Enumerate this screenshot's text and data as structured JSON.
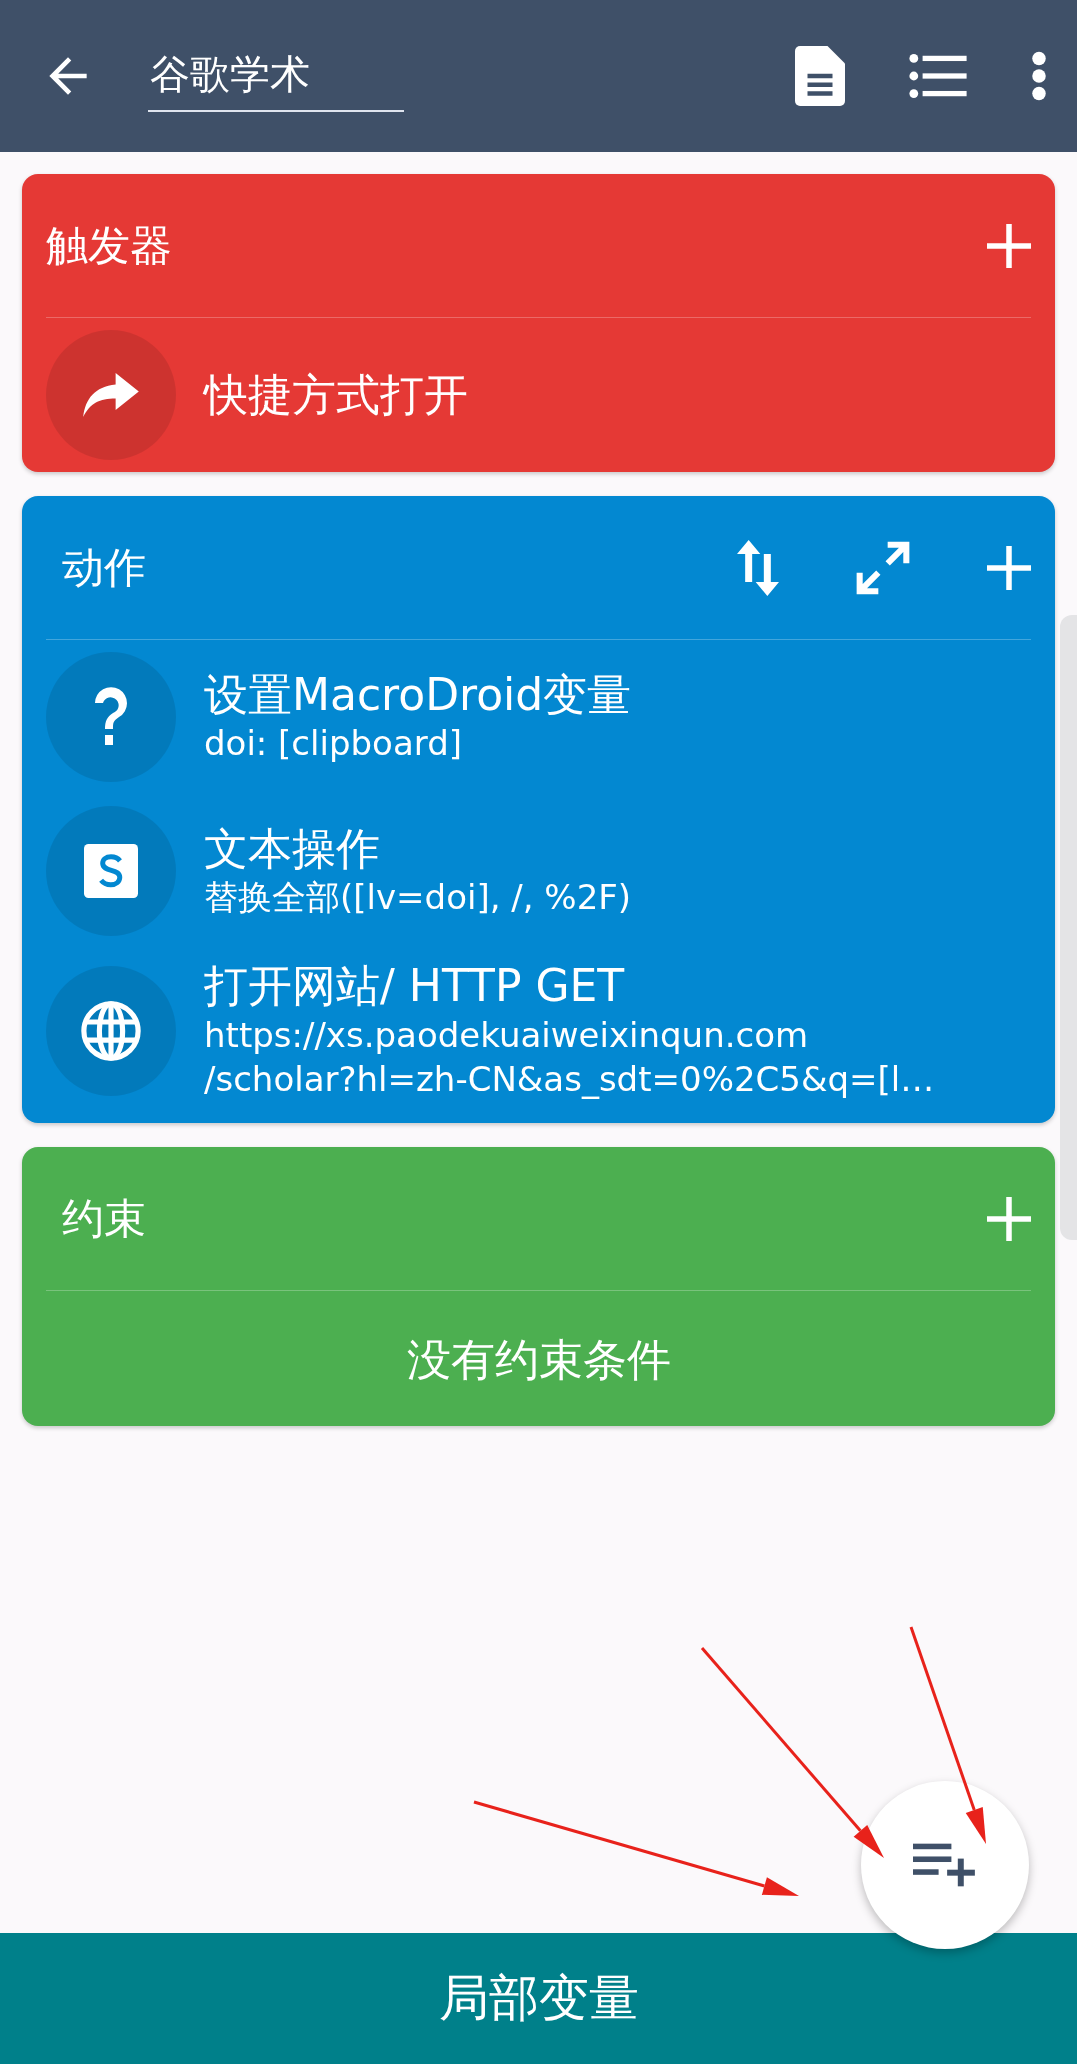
{
  "toolbar": {
    "title": "谷歌学术"
  },
  "sections": [
    {
      "kind": "trigger",
      "title": "触发器",
      "color": "#e53935",
      "items": [
        {
          "kind": "share",
          "title": "快捷方式打开"
        }
      ]
    },
    {
      "kind": "action",
      "title": "动作",
      "color": "#0388d1",
      "items": [
        {
          "kind": "help",
          "title": "设置MacroDroid变量",
          "subtitle": "doi: [clipboard]"
        },
        {
          "kind": "text",
          "title": "文本操作",
          "subtitle": "替换全部([lv=doi], /, %2F)"
        },
        {
          "kind": "web",
          "title": "打开网站/ HTTP GET",
          "subtitle": "https://xs.paodekuaiweixinqun.com\n/scholar?hl=zh-CN&as_sdt=0%2C5&q=[l…"
        }
      ]
    },
    {
      "kind": "constraint",
      "title": "约束",
      "color": "#4caf50",
      "empty_text": "没有约束条件"
    }
  ],
  "bottom_bar": {
    "label": "局部变量"
  }
}
